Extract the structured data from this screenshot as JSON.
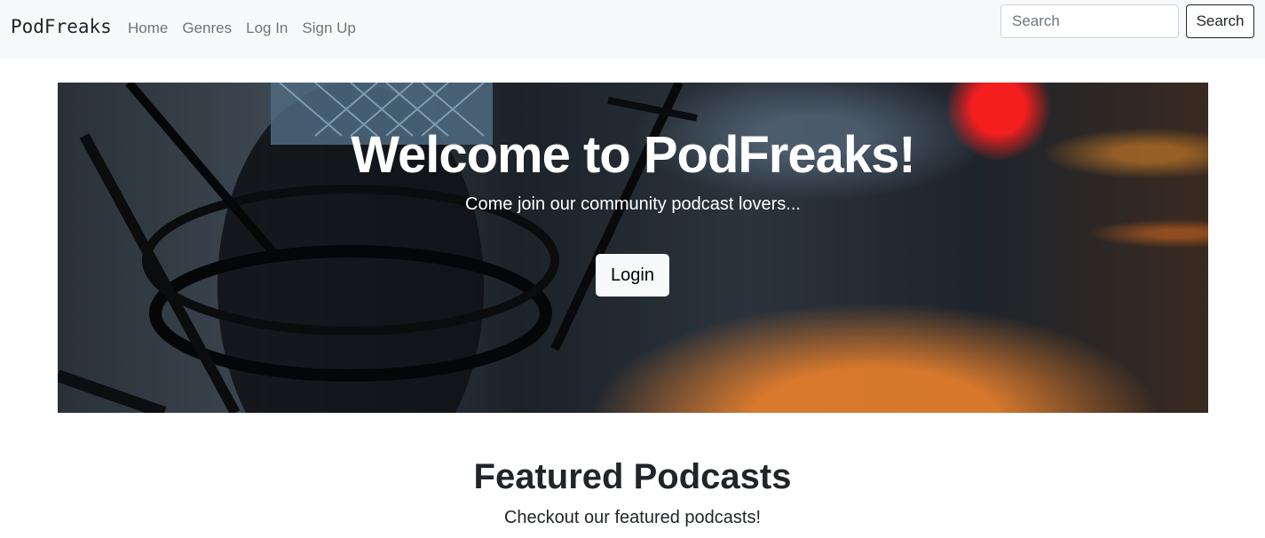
{
  "navbar": {
    "brand": "PodFreaks",
    "links": [
      "Home",
      "Genres",
      "Log In",
      "Sign Up"
    ],
    "search_placeholder": "Search",
    "search_button": "Search"
  },
  "hero": {
    "title": "Welcome to PodFreaks!",
    "subtitle": "Come join our community podcast lovers...",
    "login_button": "Login"
  },
  "featured": {
    "title": "Featured Podcasts",
    "subtitle": "Checkout our featured podcasts!"
  },
  "colors": {
    "navbar_bg": "#f8f9fa",
    "text": "#212529",
    "nav_link": "#737373"
  }
}
